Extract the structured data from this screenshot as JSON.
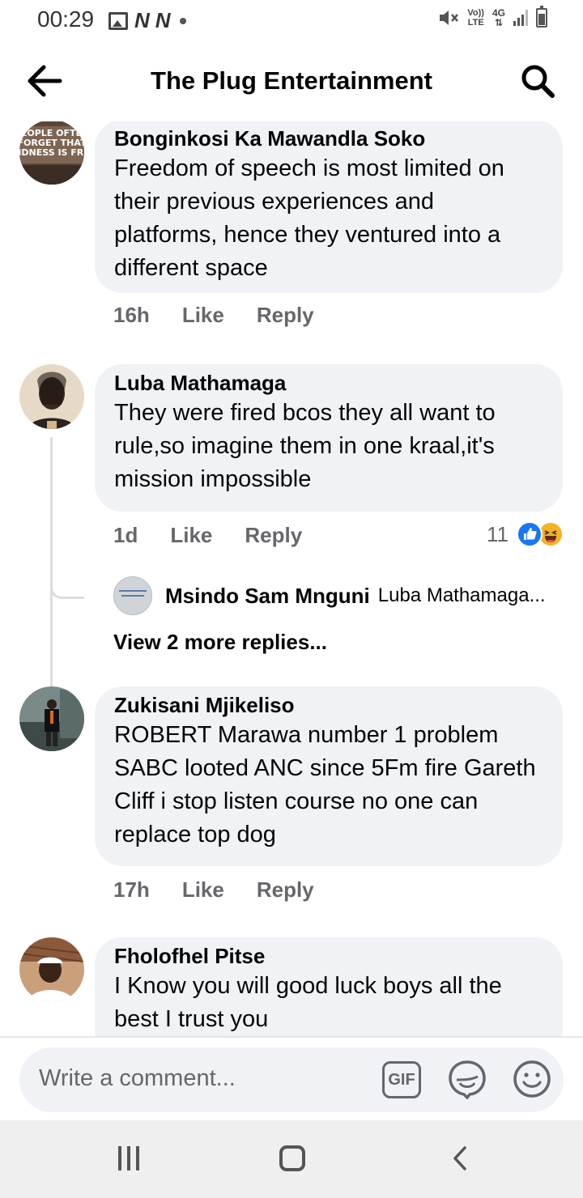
{
  "status_bar": {
    "time": "00:29",
    "left_icons": [
      "image-icon",
      "n-icon",
      "n-icon",
      "dot-icon"
    ],
    "network": {
      "volte": "Vo))",
      "lte": "LTE",
      "gen": "4G"
    },
    "right_icons": [
      "mute-icon",
      "signal-icon",
      "battery-icon"
    ]
  },
  "header": {
    "title": "The Plug Entertainment",
    "back_icon": "arrow-left-icon",
    "search_icon": "search-icon"
  },
  "comments": [
    {
      "author": "Bonginkosi Ka Mawandla Soko",
      "avatar_text": [
        "PEOPLE OFTEN",
        "FORGET THAT",
        "NDNESS IS FRE"
      ],
      "text": "Freedom of speech is most limited on their previous experiences and platforms, hence they ventured into a different space",
      "time": "16h",
      "like_label": "Like",
      "reply_label": "Reply"
    },
    {
      "author": "Luba Mathamaga",
      "text": "They were fired bcos they all want to rule,so imagine them in one kraal,it's mission impossible",
      "time": "1d",
      "like_label": "Like",
      "reply_label": "Reply",
      "reaction_count": "11",
      "reaction_icons": [
        "like-reaction-icon",
        "haha-reaction-icon"
      ],
      "reply_preview": {
        "author": "Msindo Sam Mnguni",
        "snippet": "Luba Mathamaga..."
      },
      "more_replies_label": "View 2 more replies..."
    },
    {
      "author": "Zukisani Mjikeliso",
      "text": "ROBERT Marawa number 1 problem SABC looted ANC since 5Fm fire Gareth Cliff i stop listen course no one can replace top dog",
      "time": "17h",
      "like_label": "Like",
      "reply_label": "Reply"
    },
    {
      "author": "Fholofhel Pitse",
      "text": "I Know you will good luck boys all the best I trust you"
    }
  ],
  "composer": {
    "placeholder": "Write a comment...",
    "gif_label": "GIF",
    "icons": [
      "gif-icon",
      "sticker-icon",
      "emoji-icon"
    ]
  },
  "nav": {
    "icons": [
      "recents-icon",
      "home-icon",
      "back-icon"
    ]
  },
  "colors": {
    "bubble": "#f0f2f5",
    "secondary_text": "#65676b",
    "like_blue": "#1877f2",
    "haha_yellow": "#f7b125"
  }
}
